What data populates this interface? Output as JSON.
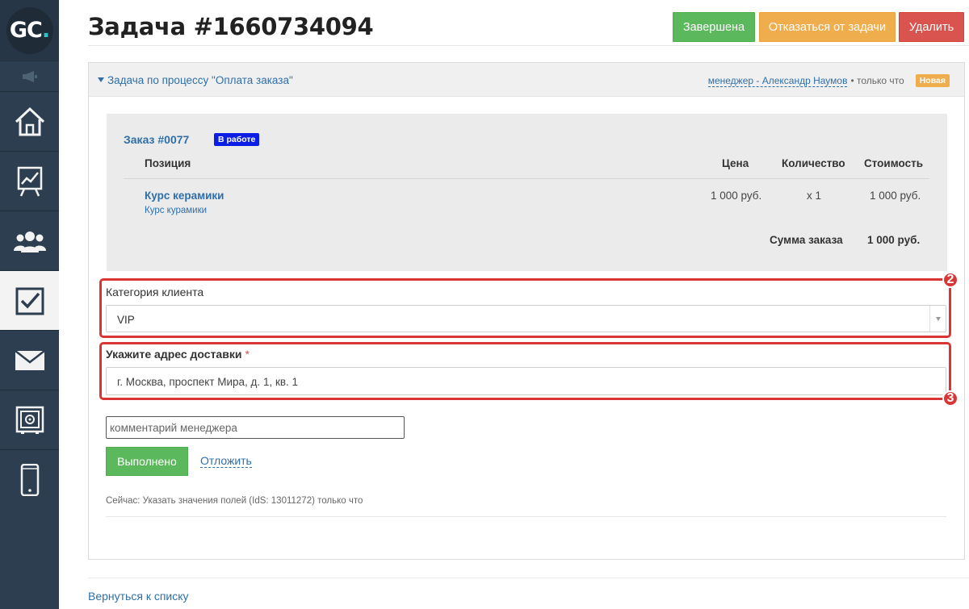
{
  "sidebar": {
    "logo_text": "GC",
    "logo_dot": ".",
    "items": [
      {
        "icon": "home-icon"
      },
      {
        "icon": "chart-icon"
      },
      {
        "icon": "users-icon"
      },
      {
        "icon": "tasks-icon",
        "active": true
      },
      {
        "icon": "mail-icon"
      },
      {
        "icon": "safe-icon"
      },
      {
        "icon": "phone-icon"
      }
    ]
  },
  "header": {
    "title": "Задача #1660734094",
    "buttons": {
      "done": "Завершена",
      "refuse": "Отказаться от задачи",
      "delete": "Удалить"
    }
  },
  "panel": {
    "process_label": "Задача по процессу \"Оплата заказа\"",
    "manager": "менеджер - Александр Наумов",
    "time": "• только что",
    "status_badge": "Новая"
  },
  "order": {
    "title": "Заказ #0077",
    "status": "В работе",
    "columns": {
      "position": "Позиция",
      "price": "Цена",
      "quantity": "Количество",
      "cost": "Стоимость"
    },
    "items": [
      {
        "name": "Курс керамики",
        "subtitle": "Курс курамики",
        "price": "1 000 руб.",
        "quantity": "x 1",
        "cost": "1 000 руб."
      }
    ],
    "total_label": "Сумма заказа",
    "total_value": "1 000 руб."
  },
  "form": {
    "category_label": "Категория клиента",
    "category_value": "VIP",
    "address_label": "Укажите адрес доставки",
    "required_mark": "*",
    "address_value": "г. Москва, проспект Мира, д. 1, кв. 1",
    "comment_placeholder": "комментарий менеджера",
    "complete_button": "Выполнено",
    "postpone_link": "Отложить",
    "status_text": "Сейчас: Указать значения полей (IdS: 13011272) только что"
  },
  "annotations": {
    "badge_2": "2",
    "badge_3": "3",
    "color": "#d93535"
  },
  "footer": {
    "back_link": "Вернуться к списку"
  },
  "colors": {
    "sidebar_bg": "#2c3e50",
    "link": "#2f6fa8",
    "success": "#5cb85c",
    "warning": "#f0ad4e",
    "danger": "#d9534f",
    "badge_work": "#0a1ee6"
  }
}
